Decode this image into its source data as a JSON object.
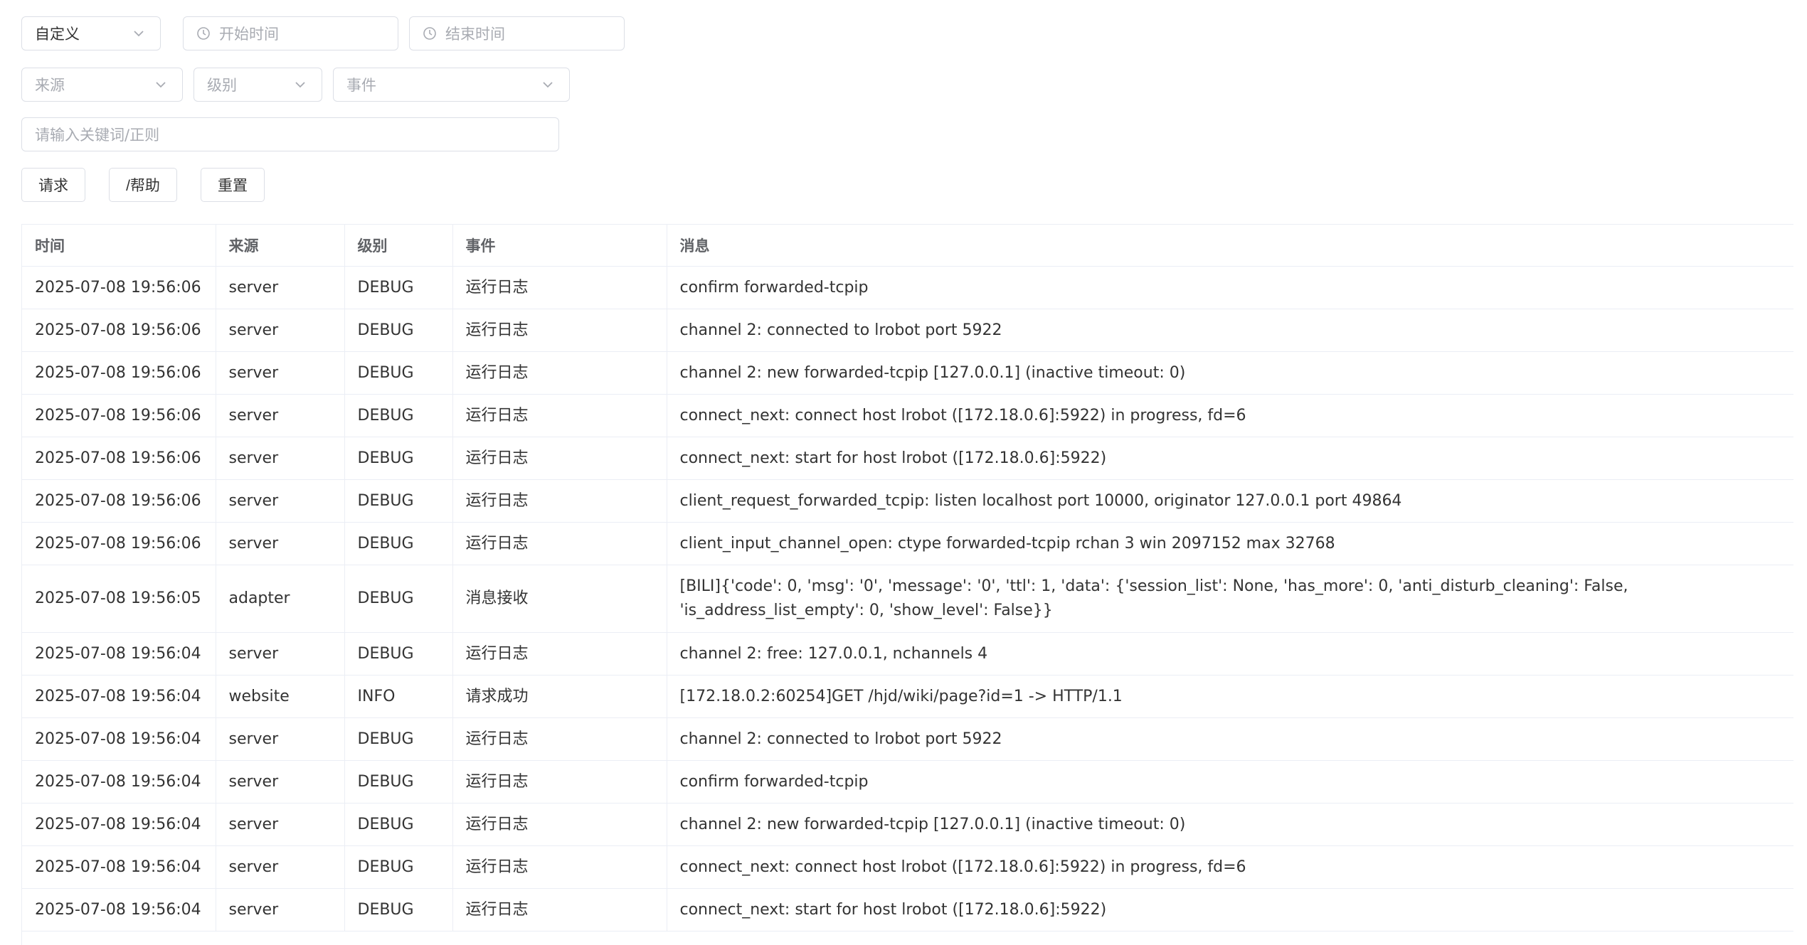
{
  "filters": {
    "range": {
      "value": "自定义"
    },
    "start_time": {
      "placeholder": "开始时间"
    },
    "end_time": {
      "placeholder": "结束时间"
    },
    "source": {
      "placeholder": "来源"
    },
    "level": {
      "placeholder": "级别"
    },
    "event": {
      "placeholder": "事件"
    },
    "keyword": {
      "placeholder": "请输入关键词/正则"
    }
  },
  "buttons": {
    "request": "请求",
    "help": "/帮助",
    "reset": "重置"
  },
  "table": {
    "columns": [
      "时间",
      "来源",
      "级别",
      "事件",
      "消息"
    ],
    "rows": [
      [
        "2025-07-08 19:56:06",
        "server",
        "DEBUG",
        "运行日志",
        "confirm forwarded-tcpip"
      ],
      [
        "2025-07-08 19:56:06",
        "server",
        "DEBUG",
        "运行日志",
        "channel 2: connected to lrobot port 5922"
      ],
      [
        "2025-07-08 19:56:06",
        "server",
        "DEBUG",
        "运行日志",
        "channel 2: new forwarded-tcpip [127.0.0.1] (inactive timeout: 0)"
      ],
      [
        "2025-07-08 19:56:06",
        "server",
        "DEBUG",
        "运行日志",
        "connect_next: connect host lrobot ([172.18.0.6]:5922) in progress, fd=6"
      ],
      [
        "2025-07-08 19:56:06",
        "server",
        "DEBUG",
        "运行日志",
        "connect_next: start for host lrobot ([172.18.0.6]:5922)"
      ],
      [
        "2025-07-08 19:56:06",
        "server",
        "DEBUG",
        "运行日志",
        "client_request_forwarded_tcpip: listen localhost port 10000, originator 127.0.0.1 port 49864"
      ],
      [
        "2025-07-08 19:56:06",
        "server",
        "DEBUG",
        "运行日志",
        "client_input_channel_open: ctype forwarded-tcpip rchan 3 win 2097152 max 32768"
      ],
      [
        "2025-07-08 19:56:05",
        "adapter",
        "DEBUG",
        "消息接收",
        "[BILI]{'code': 0, 'msg': '0', 'message': '0', 'ttl': 1, 'data': {'session_list': None, 'has_more': 0, 'anti_disturb_cleaning': False, 'is_address_list_empty': 0, 'show_level': False}}"
      ],
      [
        "2025-07-08 19:56:04",
        "server",
        "DEBUG",
        "运行日志",
        "channel 2: free: 127.0.0.1, nchannels 4"
      ],
      [
        "2025-07-08 19:56:04",
        "website",
        "INFO",
        "请求成功",
        "[172.18.0.2:60254]GET /hjd/wiki/page?id=1 -> HTTP/1.1"
      ],
      [
        "2025-07-08 19:56:04",
        "server",
        "DEBUG",
        "运行日志",
        "channel 2: connected to lrobot port 5922"
      ],
      [
        "2025-07-08 19:56:04",
        "server",
        "DEBUG",
        "运行日志",
        "confirm forwarded-tcpip"
      ],
      [
        "2025-07-08 19:56:04",
        "server",
        "DEBUG",
        "运行日志",
        "channel 2: new forwarded-tcpip [127.0.0.1] (inactive timeout: 0)"
      ],
      [
        "2025-07-08 19:56:04",
        "server",
        "DEBUG",
        "运行日志",
        "connect_next: connect host lrobot ([172.18.0.6]:5922) in progress, fd=6"
      ],
      [
        "2025-07-08 19:56:04",
        "server",
        "DEBUG",
        "运行日志",
        "connect_next: start for host lrobot ([172.18.0.6]:5922)"
      ]
    ]
  }
}
